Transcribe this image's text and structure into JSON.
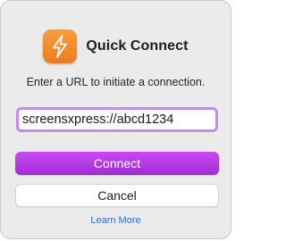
{
  "app": {
    "title": "Quick Connect",
    "icon": "lightning-bolt-icon",
    "icon_color": "#f28c28"
  },
  "dialog": {
    "prompt": "Enter a URL to initiate a connection."
  },
  "url_field": {
    "value": "screensxpress://abcd1234",
    "focus_ring_color": "#c58be7"
  },
  "buttons": {
    "connect_label": "Connect",
    "connect_color": "#b03be3",
    "cancel_label": "Cancel"
  },
  "links": {
    "learn_more": "Learn More",
    "link_color": "#2a6ed3"
  }
}
